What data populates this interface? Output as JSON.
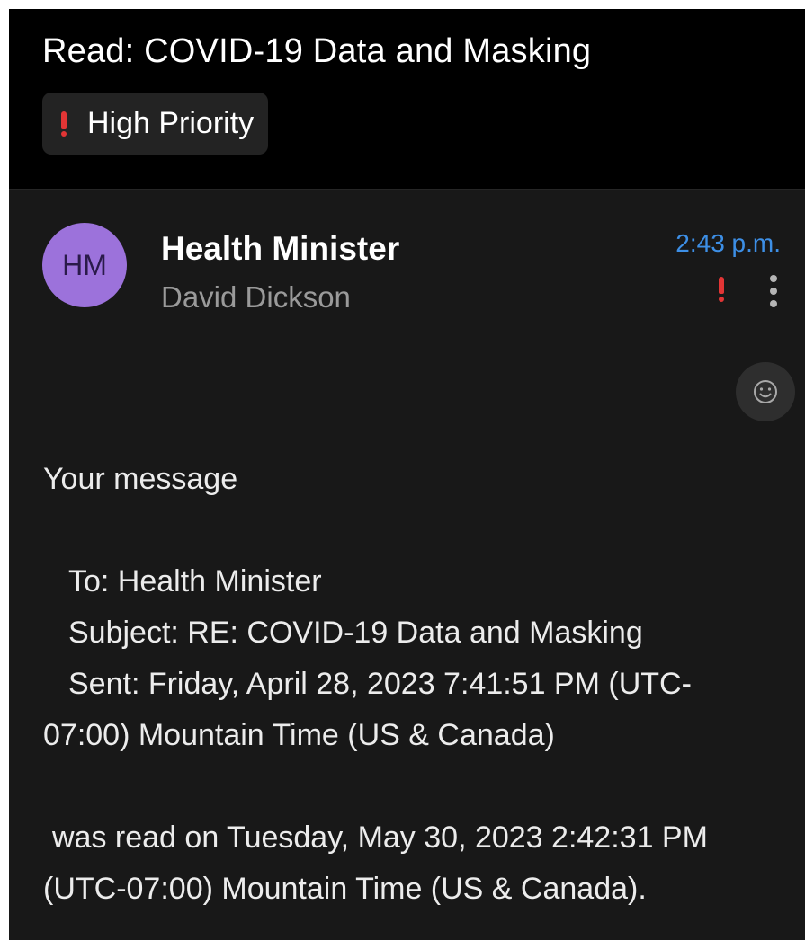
{
  "header": {
    "subject": "Read: COVID-19 Data and Masking",
    "priority_label": "High Priority"
  },
  "sender": {
    "initials": "HM",
    "name": "Health Minister",
    "secondary": "David Dickson",
    "time": "2:43 p.m."
  },
  "icons": {
    "priority": "exclamation-icon",
    "more": "more-vertical-icon",
    "reaction": "smiley-icon"
  },
  "colors": {
    "avatar": "#9c72db",
    "time": "#3d8fe6",
    "priority": "#e23535",
    "background": "#181818",
    "header_background": "#000000"
  },
  "body": {
    "intro": "Your message",
    "to": "To: Health Minister",
    "subject": "Subject: RE: COVID-19 Data and Masking",
    "sent_line1": "Sent: Friday, April 28, 2023 7:41:51 PM (UTC-",
    "sent_line2": "07:00) Mountain Time (US & Canada)",
    "read_line1": "was read on Tuesday, May 30, 2023 2:42:31 PM",
    "read_line2": "(UTC-07:00) Mountain Time (US & Canada)."
  }
}
